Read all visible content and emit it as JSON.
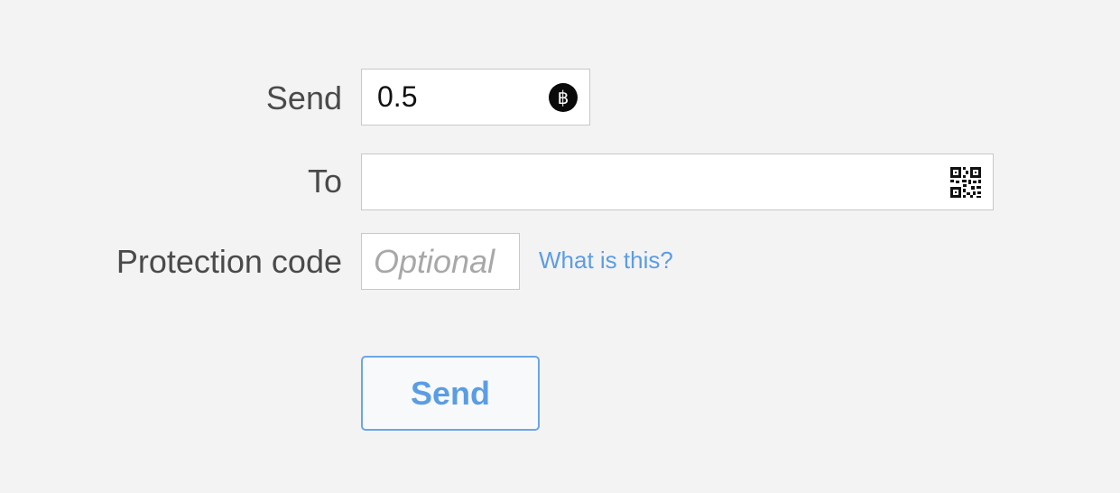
{
  "form": {
    "send_label": "Send",
    "amount_value": "0.5",
    "currency_icon": "bitcoin-icon",
    "currency_symbol": "฿",
    "to_label": "To",
    "to_value": "",
    "qr_icon": "qr-code-icon",
    "protection_label": "Protection code",
    "protection_placeholder": "Optional",
    "protection_value": "",
    "help_link": "What is this?",
    "submit_label": "Send"
  },
  "colors": {
    "background": "#f4f3f4",
    "accent": "#5b9de3",
    "label_text": "#4a4a4a",
    "placeholder": "#a8a8a8"
  }
}
